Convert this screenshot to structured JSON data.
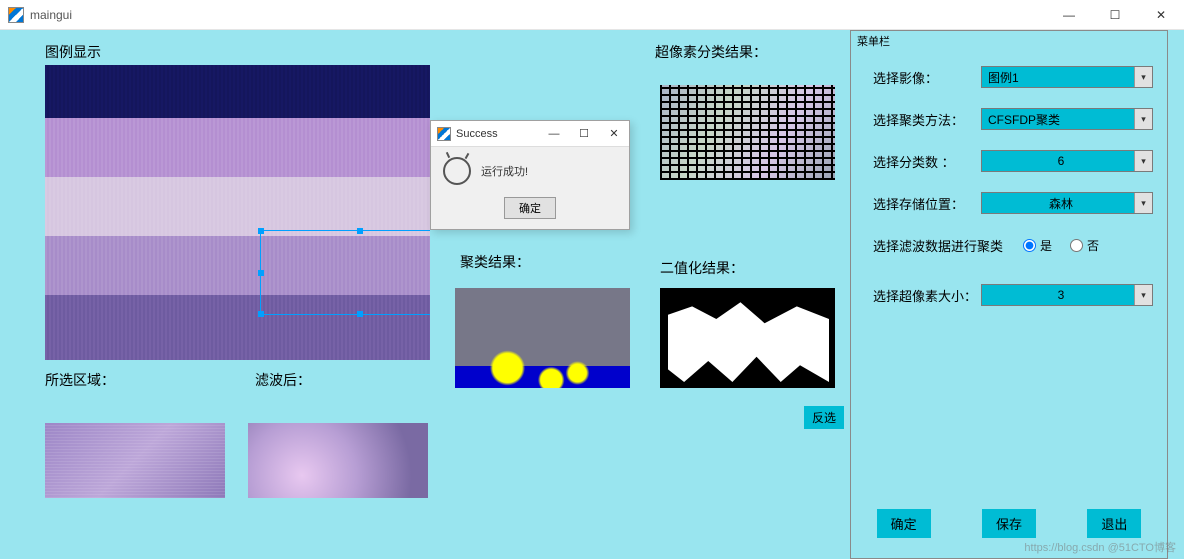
{
  "window": {
    "title": "maingui"
  },
  "labels": {
    "legend_display": "图例显示",
    "selected_region": "所选区域：",
    "after_filter": "滤波后：",
    "cluster_result": "聚类结果：",
    "superpixel_result": "超像素分类结果：",
    "binarize_result": "二值化结果："
  },
  "invert_button": "反选",
  "menu": {
    "panel_title": "菜单栏",
    "rows": {
      "select_image": {
        "label": "选择影像：",
        "value": "图例1"
      },
      "select_method": {
        "label": "选择聚类方法：",
        "value": "CFSFDP聚类"
      },
      "select_classes": {
        "label": "选择分类数 ：",
        "value": "6"
      },
      "select_storage": {
        "label": "选择存储位置：",
        "value": "森林"
      },
      "filter_for_cluster": {
        "label": "选择滤波数据进行聚类",
        "yes": "是",
        "no": "否",
        "selected": "yes"
      },
      "select_superpixel": {
        "label": "选择超像素大小：",
        "value": "3"
      }
    },
    "buttons": {
      "ok": "确定",
      "save": "保存",
      "exit": "退出"
    }
  },
  "dialog": {
    "title": "Success",
    "message": "运行成功!",
    "ok": "确定"
  },
  "watermark": "https://blog.csdn @51CTO博客"
}
